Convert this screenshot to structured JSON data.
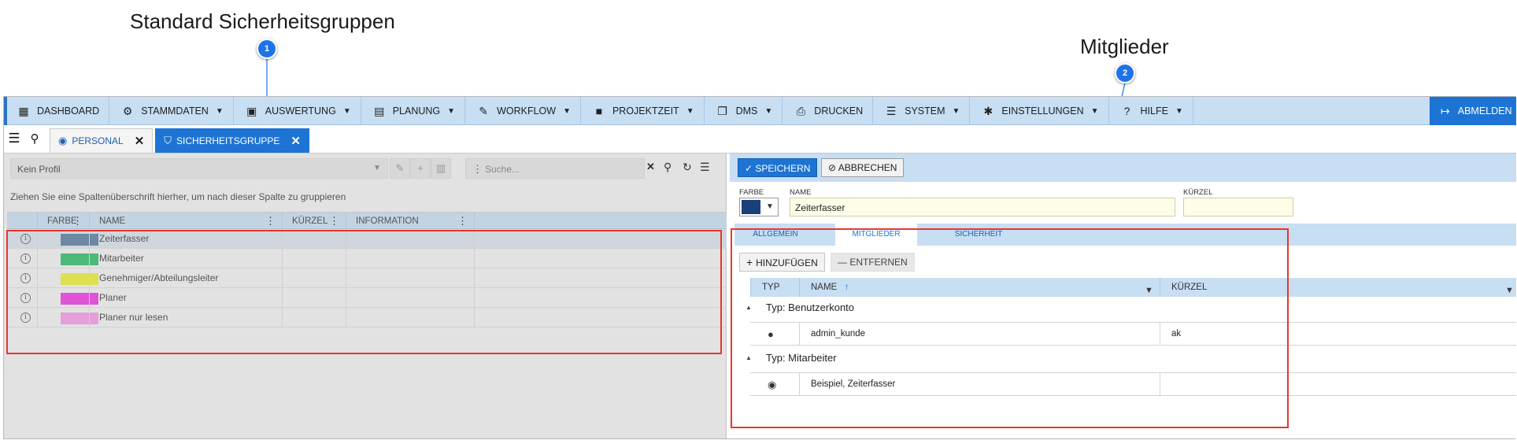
{
  "annotations": {
    "left_title": "Standard Sicherheitsgruppen",
    "right_title": "Mitglieder",
    "badge1": "1",
    "badge2": "2"
  },
  "nav": {
    "items": [
      {
        "label": "DASHBOARD",
        "icon": "dashboard-grid-icon",
        "has_caret": false
      },
      {
        "label": "STAMMDATEN",
        "icon": "gears-icon",
        "has_caret": true
      },
      {
        "label": "AUSWERTUNG",
        "icon": "calendar-icon",
        "has_caret": true
      },
      {
        "label": "PLANUNG",
        "icon": "calendar-grid-icon",
        "has_caret": true
      },
      {
        "label": "WORKFLOW",
        "icon": "pencil-icon",
        "has_caret": true
      },
      {
        "label": "PROJEKTZEIT",
        "icon": "briefcase-icon",
        "has_caret": true
      },
      {
        "label": "DMS",
        "icon": "documents-icon",
        "has_caret": true
      },
      {
        "label": "DRUCKEN",
        "icon": "printer-icon",
        "has_caret": false
      },
      {
        "label": "SYSTEM",
        "icon": "server-icon",
        "has_caret": true
      },
      {
        "label": "EINSTELLUNGEN",
        "icon": "gear-icon",
        "has_caret": true
      },
      {
        "label": "HILFE",
        "icon": "help-icon",
        "has_caret": true
      }
    ],
    "logout_label": "ABMELDEN"
  },
  "tabs": [
    {
      "label": "PERSONAL",
      "icon": "user-circle-icon",
      "active": false
    },
    {
      "label": "SICHERHEITSGRUPPE",
      "icon": "shield-icon",
      "active": true
    }
  ],
  "left": {
    "profile_placeholder": "Kein Profil",
    "search_placeholder": "Suche...",
    "group_hint": "Ziehen Sie eine Spaltenüberschrift hierher, um nach dieser Spalte zu gruppieren",
    "columns": [
      "FARBE",
      "NAME",
      "KÜRZEL",
      "INFORMATION"
    ],
    "rows": [
      {
        "name": "Zeiterfasser",
        "color": "#6e87a3",
        "selected": true
      },
      {
        "name": "Mitarbeiter",
        "color": "#4cb87a",
        "selected": false
      },
      {
        "name": "Genehmiger/Abteilungsleiter",
        "color": "#dfe04e",
        "selected": false
      },
      {
        "name": "Planer",
        "color": "#e052d6",
        "selected": false
      },
      {
        "name": "Planer nur lesen",
        "color": "#e59fd9",
        "selected": false
      }
    ]
  },
  "right": {
    "save_label": "SPEICHERN",
    "cancel_label": "ABBRECHEN",
    "farbe_label": "FARBE",
    "name_label": "NAME",
    "name_value": "Zeiterfasser",
    "kuerzel_label": "KÜRZEL",
    "kuerzel_value": "",
    "selected_color": "#1b3f7a",
    "tabs": [
      "ALLGEMEIN",
      "MITGLIEDER",
      "SICHERHEIT"
    ],
    "active_tab": "MITGLIEDER",
    "add_label": "HINZUFÜGEN",
    "remove_label": "ENTFERNEN",
    "member_columns": {
      "typ": "TYP",
      "name": "NAME",
      "sort_indicator": "↑",
      "kuerzel": "KÜRZEL"
    },
    "groups": [
      {
        "label": "Typ: Benutzerkonto",
        "members": [
          {
            "icon": "user-icon",
            "name": "admin_kunde",
            "kuerzel": "ak"
          }
        ]
      },
      {
        "label": "Typ: Mitarbeiter",
        "members": [
          {
            "icon": "user-circle-icon",
            "name": "Beispiel, Zeiterfasser",
            "kuerzel": ""
          }
        ]
      }
    ]
  }
}
